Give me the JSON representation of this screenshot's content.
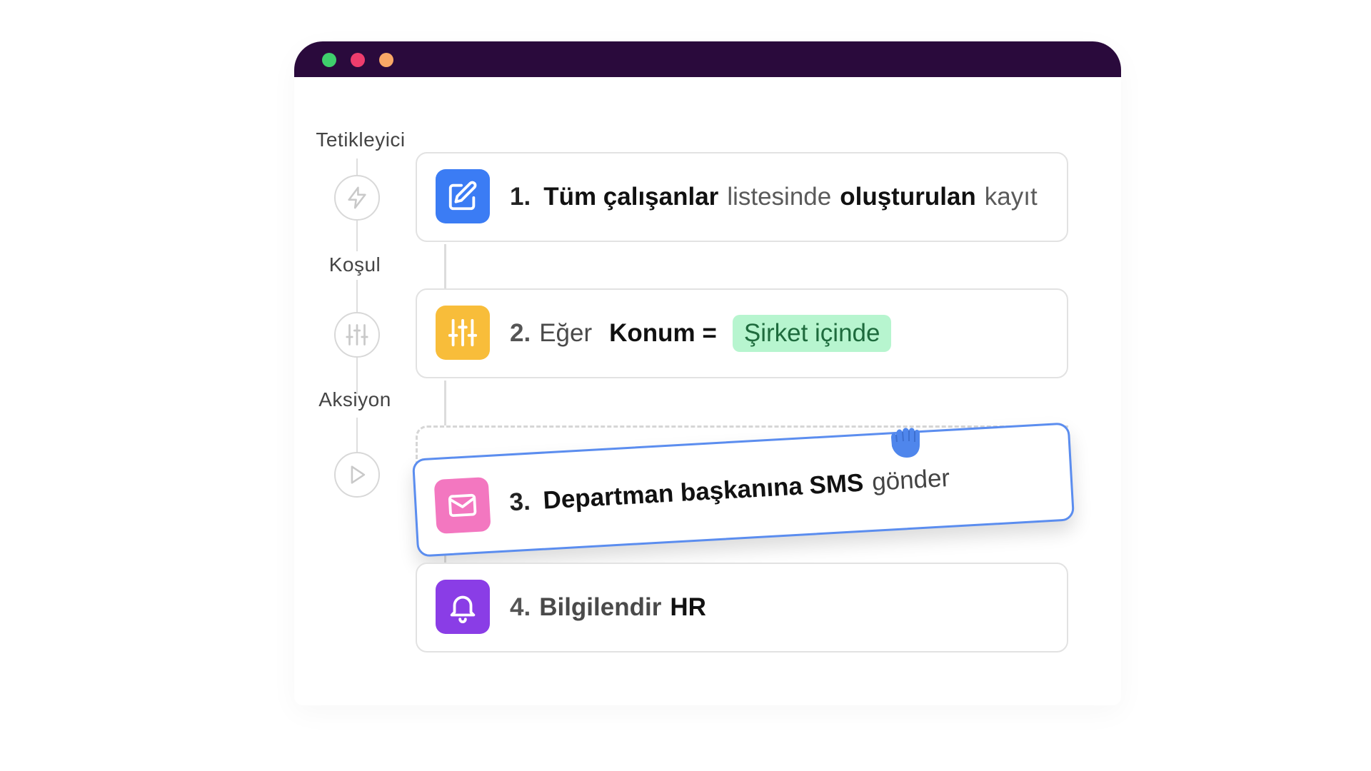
{
  "window": {
    "controls": [
      "green-dot",
      "red-dot",
      "orange-dot"
    ],
    "colors": {
      "titlebar": "#2a0a3c",
      "green": "#3fcf6c",
      "red": "#ee3d6d",
      "orange": "#f9a866"
    }
  },
  "stages": {
    "trigger": {
      "label": "Tetikleyici",
      "icon": "lightning-icon"
    },
    "condition": {
      "label": "Koşul",
      "icon": "sliders-icon"
    },
    "action": {
      "label": "Aksiyon",
      "icon": "play-icon"
    }
  },
  "steps": [
    {
      "number": "1.",
      "icon": "edit-icon",
      "icon_color": "#3b7cf4",
      "parts": [
        "Tüm çalışanlar",
        "listesinde",
        "oluşturulan",
        "kayıt"
      ]
    },
    {
      "number": "2.",
      "icon": "sliders-icon",
      "icon_color": "#f8bd3a",
      "prefix": "Eğer",
      "field": "Konum =",
      "value_chip": "Şirket içinde",
      "chip_color": "#b7f5cf"
    },
    {
      "number": "3.",
      "icon": "mail-icon",
      "icon_color": "#f377c0",
      "parts": [
        "Departman başkanına SMS",
        "gönder"
      ],
      "state": "dragging"
    },
    {
      "number": "4.",
      "icon": "bell-icon",
      "icon_color": "#8a3de6",
      "parts": [
        "Bilgilendir",
        "HR"
      ]
    }
  ],
  "cursor": {
    "icon": "grab-hand-icon",
    "color": "#4f86ec"
  }
}
